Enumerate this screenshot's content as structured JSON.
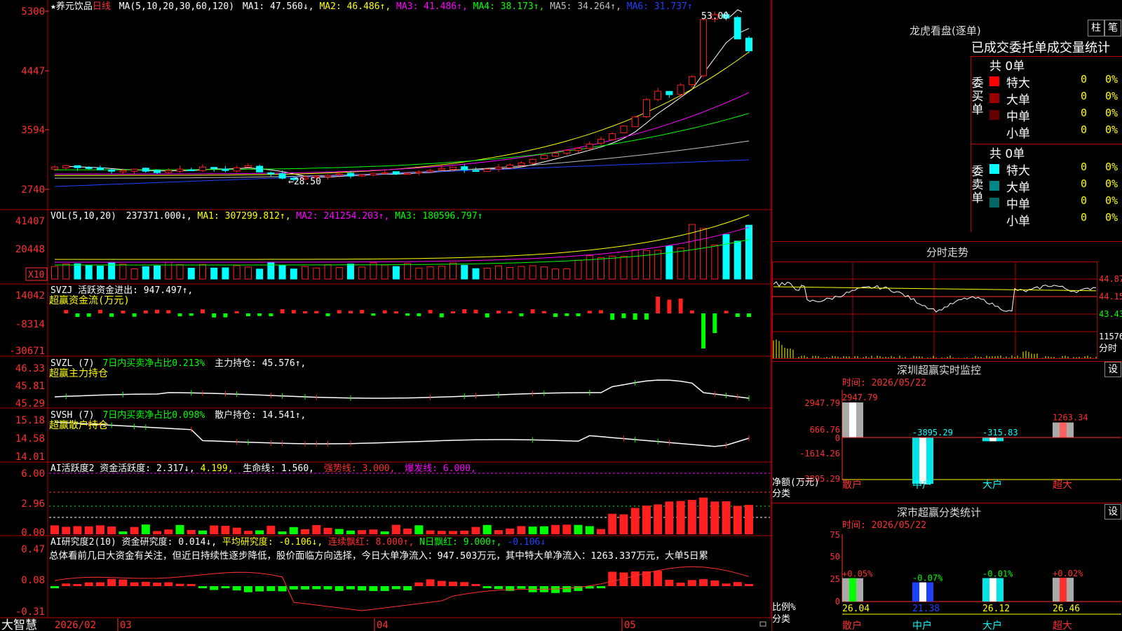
{
  "colors": {
    "up": "#ff2020",
    "down": "#00ffff",
    "ma1": "#ffffff",
    "ma2": "#ffff00",
    "ma3": "#ff00ff",
    "ma4": "#00ff00",
    "ma5": "#c0c0c0",
    "ma6": "#2040ff",
    "grid": "#b00000"
  },
  "header": {
    "star": "★",
    "stock_name": "养元饮品",
    "period": "日线",
    "ma_params": "MA(5,10,20,30,60,120)",
    "ma1": "MA1: 47.560↓,",
    "ma2": "MA2: 46.486↑,",
    "ma3": "MA3: 41.486↑,",
    "ma4": "MA4: 38.173↑,",
    "ma5": "MA5: 34.264↑,",
    "ma6": "MA6: 31.737↑"
  },
  "price_panel": {
    "y_ticks": [
      "5300",
      "4447",
      "3594",
      "2740"
    ],
    "high_label": "53.00",
    "low_label": "←28.50"
  },
  "volume_panel": {
    "header": "VOL(5,10,20)",
    "vol": "237371.000↓,",
    "ma1": "MA1: 307299.812↑,",
    "ma2": "MA2: 241254.203↑,",
    "ma3": "MA3: 180596.797↑",
    "y_ticks": [
      "41407",
      "20448"
    ],
    "multiplier": "X10"
  },
  "svzj_panel": {
    "header": "SVZJ  活跃资金进出: 947.497↑,",
    "subtitle": "超赢资金流(万元)",
    "y_ticks": [
      "14042",
      "-8314",
      "-30671"
    ]
  },
  "svzl_panel": {
    "label1": "SVZL (7)",
    "label2": "7日内买卖净占比0.213%",
    "label3": "主力持仓: 45.576↑,",
    "subtitle": "超赢主力持仓",
    "y_ticks": [
      "46.33",
      "45.81",
      "45.29"
    ]
  },
  "svsh_panel": {
    "label1": "SVSH (7)",
    "label2": "7日内买卖净占比0.098%",
    "label3": "散户持仓: 14.541↑,",
    "subtitle": "超赢散户持仓",
    "y_ticks": [
      "15.18",
      "14.58",
      "14.01"
    ]
  },
  "ai_panel": {
    "label1": "AI活跃度2 资金活跃度: 2.317↓,",
    "label2": "4.199,",
    "label3": "生命线: 1.560,",
    "label4": "强势线: 3.000,",
    "label5": "爆发线: 6.000,",
    "y_ticks": [
      "6.00",
      "2.96",
      "0.00"
    ]
  },
  "research_panel": {
    "label1": "AI研究度2(10) 资金研究度: 0.014↓,",
    "label2": "平均研究度: -0.106↓,",
    "label3": "连续飘红: 8.000↑,",
    "label4": "N日飘红: 9.000↑,",
    "label5": "-0.106↓",
    "comment": "总体看前几日大资金有关注，但近日持续性逐步降低，股价面临方向选择，今日大单净流入：947.503万元，其中特大单净流入：1263.337万元，大单5日累",
    "y_ticks": [
      "0.47",
      "0.08",
      "-0.31"
    ]
  },
  "bottom_bar": {
    "brand": "大智慧",
    "year_month": "2026/02",
    "m1": "03",
    "m2": "04",
    "m3": "05"
  },
  "right": {
    "lhb_title": "龙虎看盘(逐单)",
    "btn_bar": "柱",
    "btn_order": "笔",
    "stats_title": "已成交委托单成交量统计",
    "buy": {
      "total": "共 0单",
      "side_label": "委买单",
      "rows": [
        {
          "label": "特大",
          "count": "0",
          "pct": "0%",
          "color": "#ff0000"
        },
        {
          "label": "大单",
          "count": "0",
          "pct": "0%",
          "color": "#990000"
        },
        {
          "label": "中单",
          "count": "0",
          "pct": "0%",
          "color": "#660000"
        },
        {
          "label": "小单",
          "count": "0",
          "pct": "0%",
          "color": "#000000"
        }
      ]
    },
    "sell": {
      "total": "共 0单",
      "side_label": "委卖单",
      "rows": [
        {
          "label": "特大",
          "count": "0",
          "pct": "0%",
          "color": "#00ffff"
        },
        {
          "label": "大单",
          "count": "0",
          "pct": "0%",
          "color": "#008888"
        },
        {
          "label": "中单",
          "count": "0",
          "pct": "0%",
          "color": "#006666"
        },
        {
          "label": "小单",
          "count": "0",
          "pct": "0%",
          "color": "#000000"
        }
      ]
    },
    "intraday": {
      "title": "分时走势",
      "y_ticks": [
        "44.87",
        "44.15",
        "43.43"
      ],
      "vol_tick": "11576",
      "vol_unit": "分时"
    },
    "monitor": {
      "title": "深圳超赢实时监控",
      "btn": "设",
      "time": "时间: 2026/05/22",
      "y_ticks": [
        "2947.79",
        "666.76",
        "0",
        "-1614.26",
        "-3895.29"
      ],
      "axis_label1": "净额(万元)",
      "axis_label2": "分类",
      "categories": [
        "散户",
        "中户",
        "大户",
        "超大"
      ],
      "values": [
        2947.79,
        -3895.29,
        -315.83,
        1263.34
      ],
      "value_labels": [
        "2947.79",
        "-3895.29",
        "-315.83",
        "1263.34"
      ]
    },
    "classify": {
      "title": "深市超赢分类统计",
      "btn": "设",
      "time": "时间: 2026/05/22",
      "y_ticks": [
        "75",
        "50",
        "25",
        "0"
      ],
      "axis_label1": "比例%",
      "axis_label2": "分类",
      "categories": [
        "散户",
        "中户",
        "大户",
        "超大"
      ],
      "values": [
        26.04,
        21.38,
        26.12,
        26.46
      ],
      "value_labels": [
        "26.04",
        "21.38",
        "26.12",
        "26.46"
      ],
      "change_labels": [
        "+0.05%",
        "-0.07%",
        "-0.01%",
        "+0.02%"
      ]
    }
  }
}
